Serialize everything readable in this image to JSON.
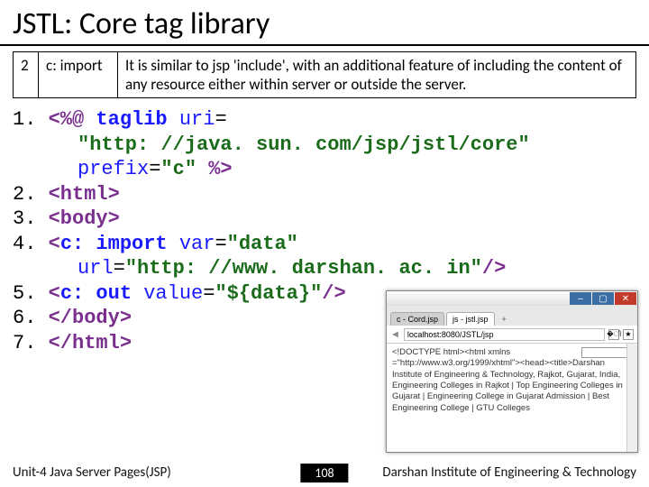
{
  "title": "JSTL: Core tag library",
  "table": {
    "num": "2",
    "tag": "c: import",
    "desc": "It is similar to jsp 'include', with an additional feature of including the content of any resource either within server or outside the server."
  },
  "code": {
    "l1_n": "1.",
    "l1_a": "<%@",
    "l1_b": "taglib",
    "l1_c": "uri",
    "l1_d": "=",
    "l1_e": "\"http: //java. sun. com/jsp/jstl/core\"",
    "l1_f": "prefix",
    "l1_g": "=",
    "l1_h": "\"c\"",
    "l1_i": "%>",
    "l2_n": "2.",
    "l2_a": "<html>",
    "l3_n": "3.",
    "l3_a": "<body>",
    "l4_n": "4.",
    "l4_a": "<",
    "l4_b": "c: import",
    "l4_c": "var",
    "l4_d": "=",
    "l4_e": "\"data\"",
    "l4_f": "url",
    "l4_g": "=",
    "l4_h": "\"http: //www. darshan. ac. in\"",
    "l4_i": "/>",
    "l5_n": "5.",
    "l5_a": "<",
    "l5_b": "c: out",
    "l5_c": "value",
    "l5_d": "=",
    "l5_e": "\"${data}\"",
    "l5_f": "/>",
    "l6_n": "6.",
    "l6_a": "</body>",
    "l7_n": "7.",
    "l7_a": "</html>"
  },
  "footer": {
    "unit": "Unit-4 Java Server Pages(JSP)",
    "page": "108",
    "inst": "Darshan Institute of Engineering & Technology"
  },
  "preview": {
    "tab1": "c - Cord.jsp",
    "tab2": "js - jstl.jsp",
    "url": "localhost:8080/JSTL/jsp",
    "body1": "<!DOCTYPE html><html xmlns =\"http://www.w3.org/1999/xhtml\"><head><title>Darshan Institute of Engineering & Technology, Rajkot, Gujarat, India, Engineering Colleges in Rajkot | Top Engineering Colleges in Gujarat | Engineering College in Gujarat Admission | Best Engineering College | GTU Colleges"
  }
}
